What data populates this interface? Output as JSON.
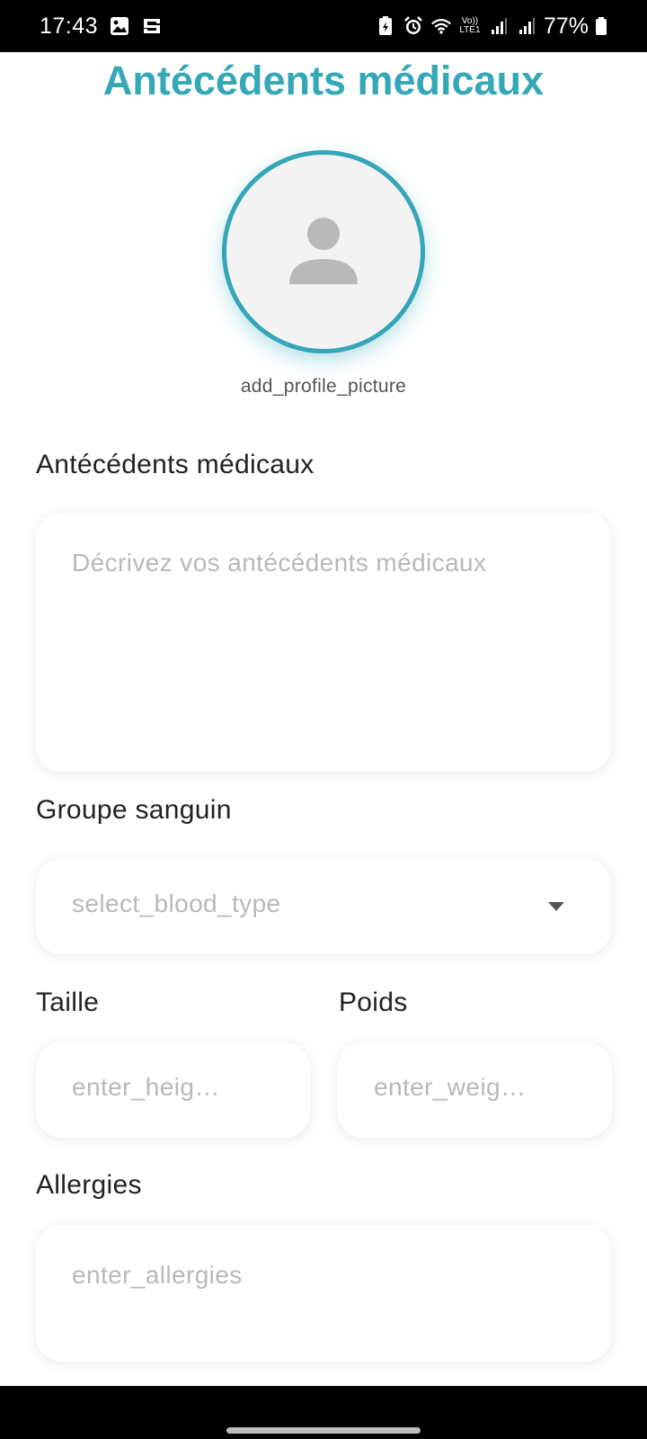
{
  "status_bar": {
    "time": "17:43",
    "battery_percent": "77%",
    "network_label": "Vo)) LTE1",
    "icons": [
      "gallery-icon",
      "cast-icon",
      "battery-saver-icon",
      "alarm-icon",
      "wifi-icon",
      "signal-icon",
      "signal-icon-2",
      "battery-icon"
    ]
  },
  "page": {
    "title": "Antécédents médicaux"
  },
  "avatar": {
    "caption": "add_profile_picture",
    "accent_color": "#35a8b8"
  },
  "form": {
    "history": {
      "label": "Antécédents médicaux",
      "placeholder": "Décrivez vos antécédents médicaux"
    },
    "blood_type": {
      "label": "Groupe sanguin",
      "placeholder": "select_blood_type"
    },
    "height": {
      "label": "Taille",
      "placeholder": "enter_heig…"
    },
    "weight": {
      "label": "Poids",
      "placeholder": "enter_weig…"
    },
    "allergies": {
      "label": "Allergies",
      "placeholder": "enter_allergies"
    }
  }
}
